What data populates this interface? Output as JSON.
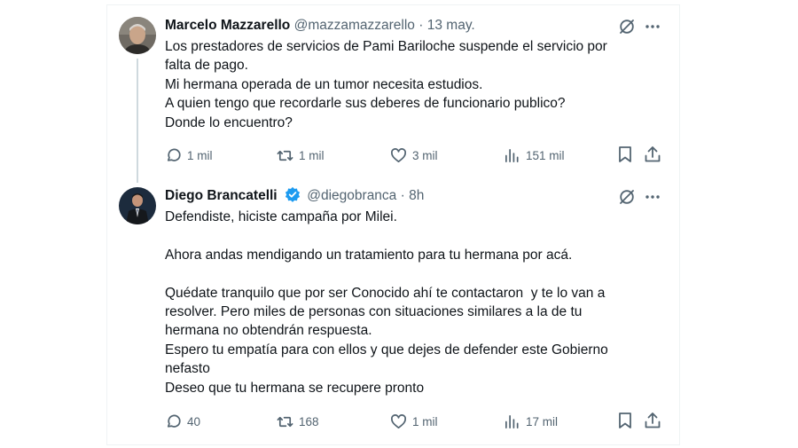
{
  "tweets": [
    {
      "author_name": "Marcelo Mazzarello",
      "handle": "@mazzamazzarello",
      "separator": "·",
      "time": "13 may.",
      "verified": false,
      "lines": [
        "Los prestadores de servicios de Pami Bariloche suspende el servicio por",
        "falta de pago.",
        "Mi hermana operada de un tumor necesita estudios.",
        "A quien tengo que recordarle sus deberes de funcionario publico?",
        "Donde lo encuentro?"
      ],
      "replies": "1 mil",
      "reposts": "1 mil",
      "likes": "3 mil",
      "views": "151 mil"
    },
    {
      "author_name": "Diego Brancatelli",
      "handle": "@diegobranca",
      "separator": "·",
      "time": "8h",
      "verified": true,
      "lines": [
        "Defendiste, hiciste campaña por Milei.",
        "",
        "Ahora andas mendigando un tratamiento para tu hermana por acá.",
        "",
        "Quédate tranquilo que por ser Conocido ahí te contactaron  y te lo van a",
        "resolver. Pero miles de personas con situaciones similares a la de tu",
        "hermana no obtendrán respuesta.",
        "Espero tu empatía para con ellos y que dejes de defender este Gobierno",
        "nefasto",
        "Deseo que tu hermana se recupere pronto"
      ],
      "replies": "40",
      "reposts": "168",
      "likes": "1 mil",
      "views": "17 mil"
    }
  ],
  "colors": {
    "text": "#0f1419",
    "secondary": "#536471",
    "verified_badge": "#1d9bf0",
    "thread_line": "#cfd9de"
  },
  "icons": [
    "grok-icon",
    "more-icon",
    "reply-icon",
    "repost-icon",
    "like-icon",
    "views-icon",
    "bookmark-icon",
    "share-icon",
    "verified-badge-icon"
  ]
}
